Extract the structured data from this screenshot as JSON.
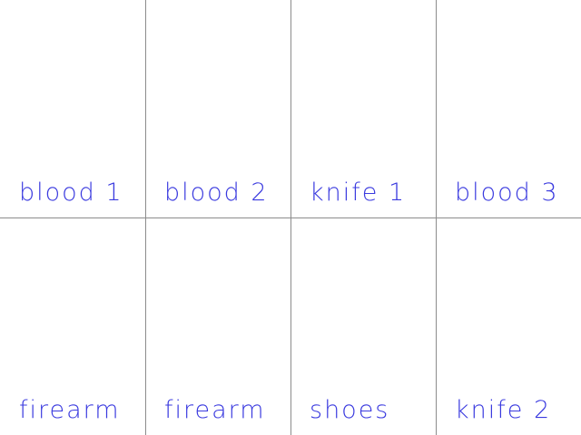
{
  "label_color": "#3a3adf",
  "line_color": "#8c8c8c",
  "rows": [
    {
      "cells": [
        {
          "label": "blood 1"
        },
        {
          "label": "blood 2"
        },
        {
          "label": "knife 1"
        },
        {
          "label": "blood 3"
        }
      ]
    },
    {
      "cells": [
        {
          "label": "firearm"
        },
        {
          "label": "firearm"
        },
        {
          "label": "shoes"
        },
        {
          "label": "knife 2"
        }
      ]
    }
  ]
}
